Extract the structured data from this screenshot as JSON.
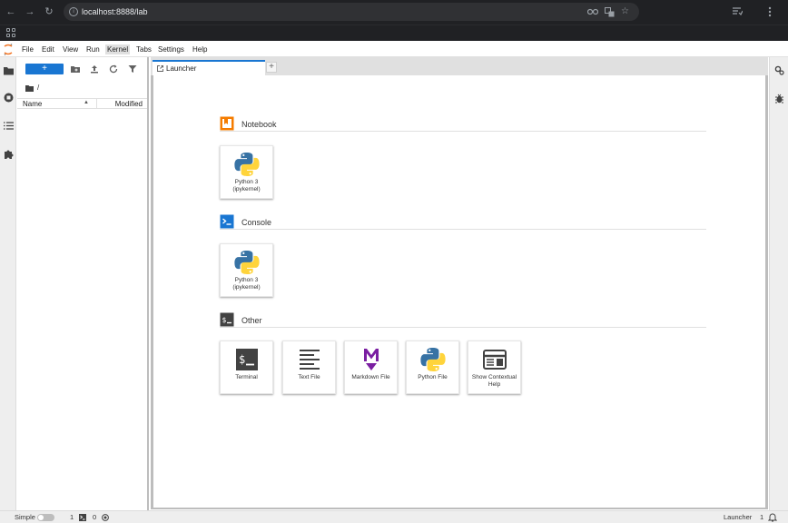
{
  "browser": {
    "url": "localhost:8888/lab",
    "back_glyph": "←",
    "forward_glyph": "→",
    "reload_glyph": "↻",
    "star_glyph": "☆"
  },
  "menu": {
    "items": [
      "File",
      "Edit",
      "View",
      "Run",
      "Kernel",
      "Tabs",
      "Settings",
      "Help"
    ],
    "active": "Kernel"
  },
  "filebrowser": {
    "new_label": "+",
    "path": "/",
    "columns": {
      "name": "Name",
      "modified": "Modified"
    },
    "sort_glyph": "▲"
  },
  "tabs": [
    {
      "label": "Launcher"
    }
  ],
  "add_tab_glyph": "+",
  "launcher": {
    "sections": [
      {
        "title": "Notebook",
        "icon": "notebook-icon",
        "cards": [
          {
            "label": "Python 3 (ipykernel)",
            "icon": "python-logo-icon"
          }
        ]
      },
      {
        "title": "Console",
        "icon": "console-icon",
        "cards": [
          {
            "label": "Python 3 (ipykernel)",
            "icon": "python-logo-icon"
          }
        ]
      },
      {
        "title": "Other",
        "icon": "terminal-section-icon",
        "cards": [
          {
            "label": "Terminal",
            "icon": "terminal-icon"
          },
          {
            "label": "Text File",
            "icon": "text-file-icon"
          },
          {
            "label": "Markdown File",
            "icon": "markdown-icon"
          },
          {
            "label": "Python File",
            "icon": "python-logo-icon"
          },
          {
            "label": "Show Contextual Help",
            "icon": "contextual-help-icon"
          }
        ]
      }
    ]
  },
  "statusbar": {
    "mode_label": "Simple",
    "terminals_count": "1",
    "kernels_count": "0",
    "active_tab": "Launcher",
    "notifications_count": "1"
  },
  "colors": {
    "accent": "#1976d2",
    "notebook_orange": "#f57c00",
    "markdown_purple": "#7b1fa2",
    "python_blue": "#3772a4",
    "python_yellow": "#ffd43b"
  }
}
